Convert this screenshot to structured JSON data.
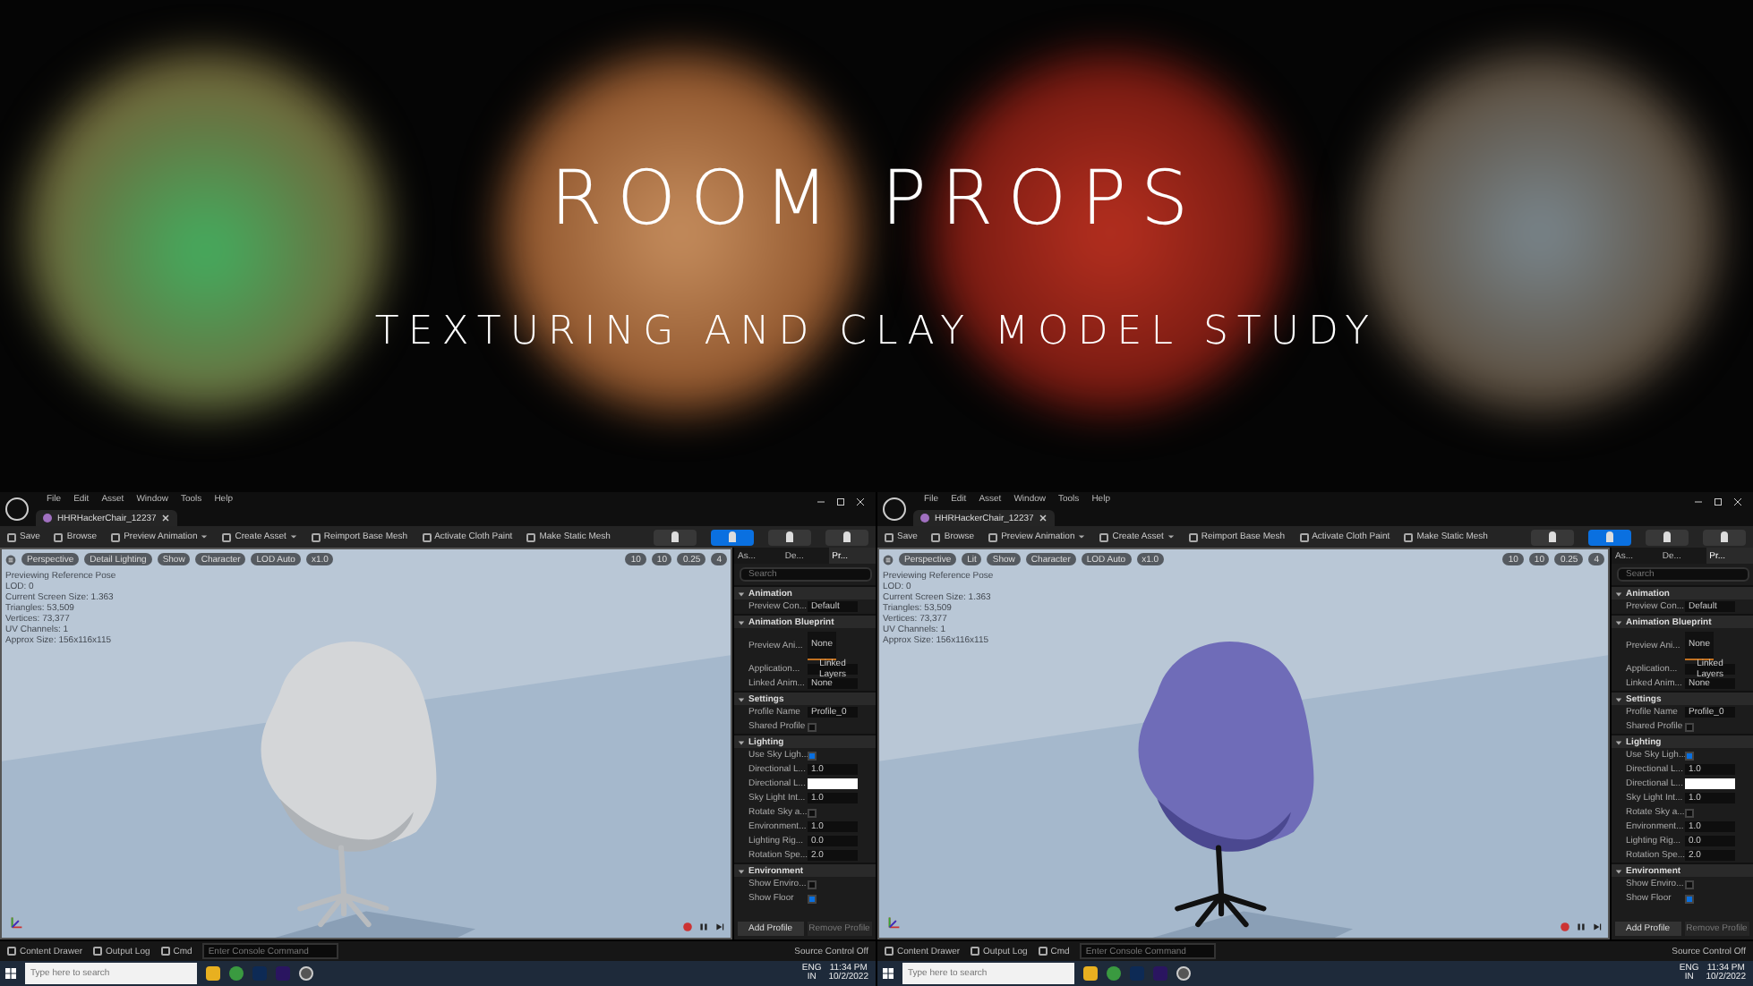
{
  "banner": {
    "title": "ROOM PROPS",
    "subtitle": "TEXTURING AND CLAY MODEL STUDY"
  },
  "editors": [
    {
      "kind": "clay",
      "menu": [
        "File",
        "Edit",
        "Asset",
        "Window",
        "Tools",
        "Help"
      ],
      "tab": "HHRHackerChair_12237",
      "toolbar": [
        {
          "label": "Save",
          "dropdown": false
        },
        {
          "label": "Browse",
          "dropdown": false
        },
        {
          "label": "Preview Animation",
          "dropdown": true
        },
        {
          "label": "Create Asset",
          "dropdown": true
        },
        {
          "label": "Reimport Base Mesh",
          "dropdown": false
        },
        {
          "label": "Activate Cloth Paint",
          "dropdown": false
        },
        {
          "label": "Make Static Mesh",
          "dropdown": false
        }
      ],
      "modes": [
        {
          "selected": false
        },
        {
          "selected": true
        },
        {
          "selected": false
        },
        {
          "selected": false
        }
      ],
      "viewport_buttons": [
        "Perspective",
        "Detail Lighting",
        "Show",
        "Character",
        "LOD Auto",
        "x1.0"
      ],
      "viewport_values": [
        "10",
        "10",
        "0.25",
        "4"
      ],
      "stats": [
        "Previewing Reference Pose",
        "LOD: 0",
        "Current Screen Size: 1.363",
        "Triangles: 53,509",
        "Vertices: 73,377",
        "UV Channels: 1",
        "Approx Size: 156x116x115"
      ],
      "panel_tabs": [
        {
          "label": "As...",
          "selected": false
        },
        {
          "label": "De...",
          "selected": false
        },
        {
          "label": "Pr...",
          "selected": true
        }
      ],
      "search": {
        "placeholder": "Search"
      },
      "sections": [
        {
          "title": "Animation",
          "expanded": true,
          "rows": [
            {
              "kind": "dropdown",
              "label": "Preview Con...",
              "value": "Default"
            }
          ]
        },
        {
          "title": "Animation Blueprint",
          "expanded": true,
          "rows": [
            {
              "kind": "asset",
              "label": "Preview Ani...",
              "value": "None"
            },
            {
              "kind": "dropdown",
              "label": "Application...",
              "value": "Linked Layers"
            },
            {
              "kind": "text",
              "label": "Linked Anim...",
              "value": "None"
            }
          ]
        },
        {
          "title": "Settings",
          "expanded": true,
          "rows": [
            {
              "kind": "text",
              "label": "Profile Name",
              "value": "Profile_0"
            },
            {
              "kind": "checkbox",
              "label": "Shared Profile",
              "checked": false
            }
          ]
        },
        {
          "title": "Lighting",
          "expanded": true,
          "rows": [
            {
              "kind": "checkbox",
              "label": "Use Sky Ligh...",
              "checked": true
            },
            {
              "kind": "text",
              "label": "Directional L...",
              "value": "1.0"
            },
            {
              "kind": "color",
              "label": "Directional L...",
              "color": "#ffffff"
            },
            {
              "kind": "text",
              "label": "Sky Light Int...",
              "value": "1.0"
            },
            {
              "kind": "checkbox",
              "label": "Rotate Sky a...",
              "checked": false
            },
            {
              "kind": "text",
              "label": "Environment...",
              "value": "1.0"
            },
            {
              "kind": "text",
              "label": "Lighting Rig...",
              "value": "0.0"
            },
            {
              "kind": "text",
              "label": "Rotation Spe...",
              "value": "2.0"
            }
          ]
        },
        {
          "title": "Environment",
          "expanded": true,
          "rows": [
            {
              "kind": "checkbox",
              "label": "Show Enviro...",
              "checked": false
            },
            {
              "kind": "checkbox",
              "label": "Show Floor",
              "checked": true
            }
          ]
        }
      ],
      "panel_buttons": [
        "Add Profile",
        "Remove Profile"
      ],
      "status": {
        "items": [
          "Content Drawer",
          "Output Log",
          "Cmd"
        ],
        "console_placeholder": "Enter Console Command",
        "source_control": "Source Control Off"
      },
      "taskbar": {
        "search_placeholder": "Type here to search",
        "language": [
          "ENG",
          "IN"
        ],
        "time": "11:34 PM",
        "date": "10/2/2022"
      }
    },
    {
      "kind": "textured",
      "menu": [
        "File",
        "Edit",
        "Asset",
        "Window",
        "Tools",
        "Help"
      ],
      "tab": "HHRHackerChair_12237",
      "toolbar": [
        {
          "label": "Save",
          "dropdown": false
        },
        {
          "label": "Browse",
          "dropdown": false
        },
        {
          "label": "Preview Animation",
          "dropdown": true
        },
        {
          "label": "Create Asset",
          "dropdown": true
        },
        {
          "label": "Reimport Base Mesh",
          "dropdown": false
        },
        {
          "label": "Activate Cloth Paint",
          "dropdown": false
        },
        {
          "label": "Make Static Mesh",
          "dropdown": false
        }
      ],
      "modes": [
        {
          "selected": false
        },
        {
          "selected": true
        },
        {
          "selected": false
        },
        {
          "selected": false
        }
      ],
      "viewport_buttons": [
        "Perspective",
        "Lit",
        "Show",
        "Character",
        "LOD Auto",
        "x1.0"
      ],
      "viewport_values": [
        "10",
        "10",
        "0.25",
        "4"
      ],
      "stats": [
        "Previewing Reference Pose",
        "LOD: 0",
        "Current Screen Size: 1.363",
        "Triangles: 53,509",
        "Vertices: 73,377",
        "UV Channels: 1",
        "Approx Size: 156x116x115"
      ],
      "panel_tabs": [
        {
          "label": "As...",
          "selected": false
        },
        {
          "label": "De...",
          "selected": false
        },
        {
          "label": "Pr...",
          "selected": true
        }
      ],
      "search": {
        "placeholder": "Search"
      },
      "sections": [
        {
          "title": "Animation",
          "expanded": true,
          "rows": [
            {
              "kind": "dropdown",
              "label": "Preview Con...",
              "value": "Default"
            }
          ]
        },
        {
          "title": "Animation Blueprint",
          "expanded": true,
          "rows": [
            {
              "kind": "asset",
              "label": "Preview Ani...",
              "value": "None"
            },
            {
              "kind": "dropdown",
              "label": "Application...",
              "value": "Linked Layers"
            },
            {
              "kind": "text",
              "label": "Linked Anim...",
              "value": "None"
            }
          ]
        },
        {
          "title": "Settings",
          "expanded": true,
          "rows": [
            {
              "kind": "text",
              "label": "Profile Name",
              "value": "Profile_0"
            },
            {
              "kind": "checkbox",
              "label": "Shared Profile",
              "checked": false
            }
          ]
        },
        {
          "title": "Lighting",
          "expanded": true,
          "rows": [
            {
              "kind": "checkbox",
              "label": "Use Sky Ligh...",
              "checked": true
            },
            {
              "kind": "text",
              "label": "Directional L...",
              "value": "1.0"
            },
            {
              "kind": "color",
              "label": "Directional L...",
              "color": "#ffffff"
            },
            {
              "kind": "text",
              "label": "Sky Light Int...",
              "value": "1.0"
            },
            {
              "kind": "checkbox",
              "label": "Rotate Sky a...",
              "checked": false
            },
            {
              "kind": "text",
              "label": "Environment...",
              "value": "1.0"
            },
            {
              "kind": "text",
              "label": "Lighting Rig...",
              "value": "0.0"
            },
            {
              "kind": "text",
              "label": "Rotation Spe...",
              "value": "2.0"
            }
          ]
        },
        {
          "title": "Environment",
          "expanded": true,
          "rows": [
            {
              "kind": "checkbox",
              "label": "Show Enviro...",
              "checked": false
            },
            {
              "kind": "checkbox",
              "label": "Show Floor",
              "checked": true
            }
          ]
        }
      ],
      "panel_buttons": [
        "Add Profile",
        "Remove Profile"
      ],
      "status": {
        "items": [
          "Content Drawer",
          "Output Log",
          "Cmd"
        ],
        "console_placeholder": "Enter Console Command",
        "source_control": "Source Control Off"
      },
      "taskbar": {
        "search_placeholder": "Type here to search",
        "language": [
          "ENG",
          "IN"
        ],
        "time": "11:34 PM",
        "date": "10/2/2022"
      }
    }
  ]
}
